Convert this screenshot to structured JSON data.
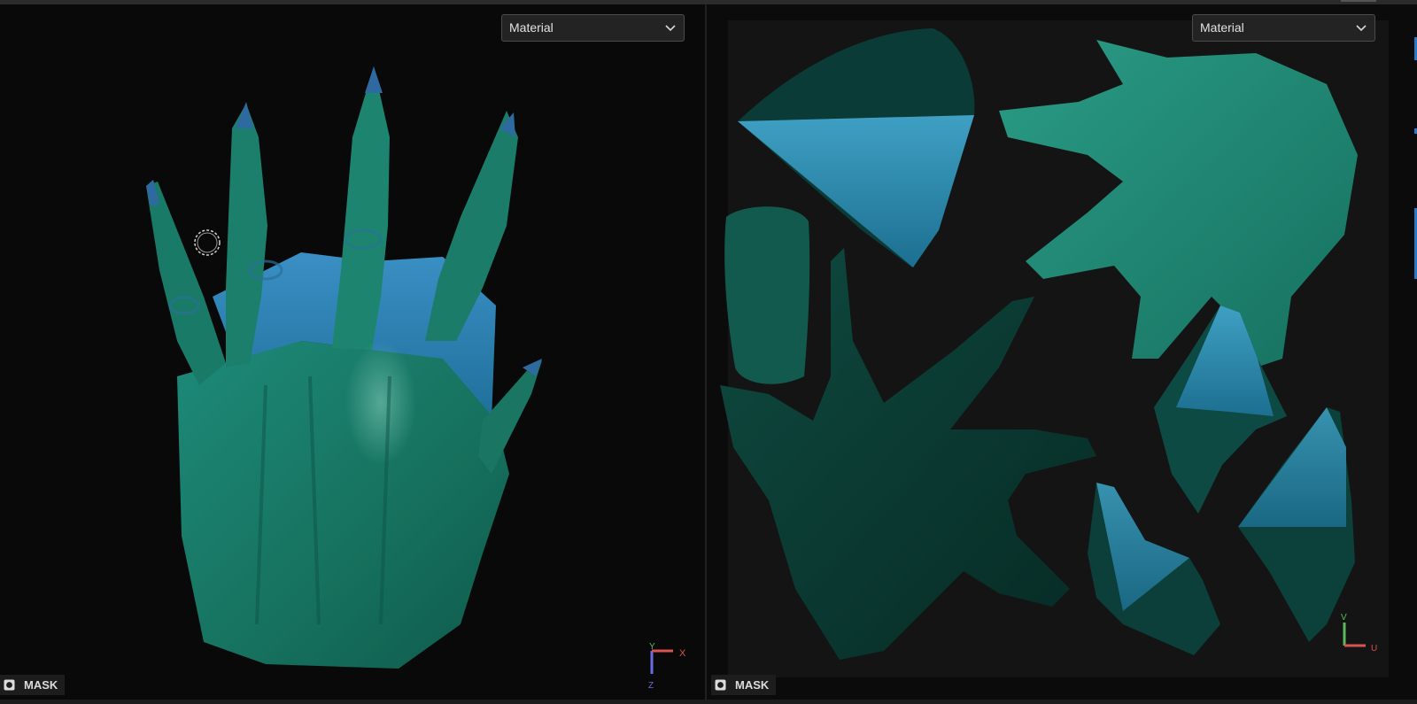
{
  "left_viewport": {
    "view_mode": {
      "selected": "Material",
      "icon": "chevron-down-icon"
    },
    "mask_toggle": {
      "label": "MASK",
      "icon": "mask-toggle-icon"
    },
    "axis_gizmo": {
      "labels": [
        "Y",
        "X",
        "Z"
      ],
      "colors": {
        "x": "#d9534f",
        "y": "#5cb85c",
        "z": "#5b5bd6"
      }
    },
    "brush_cursor": "brush-cursor-icon",
    "model": "hand-mesh"
  },
  "right_viewport": {
    "view_mode": {
      "selected": "Material",
      "icon": "chevron-down-icon"
    },
    "mask_toggle": {
      "label": "MASK",
      "icon": "mask-toggle-icon"
    },
    "uv_gizmo": {
      "labels": [
        "V",
        "U"
      ],
      "colors": {
        "u": "#d9534f",
        "v": "#5cb85c"
      }
    },
    "model": "uv-layout"
  },
  "colors": {
    "background": "#0b0b0b",
    "uv_background": "#141414",
    "skin_green": "#1f7f6e",
    "skin_blue": "#2b6f9b",
    "accent": "#2c78c8"
  }
}
